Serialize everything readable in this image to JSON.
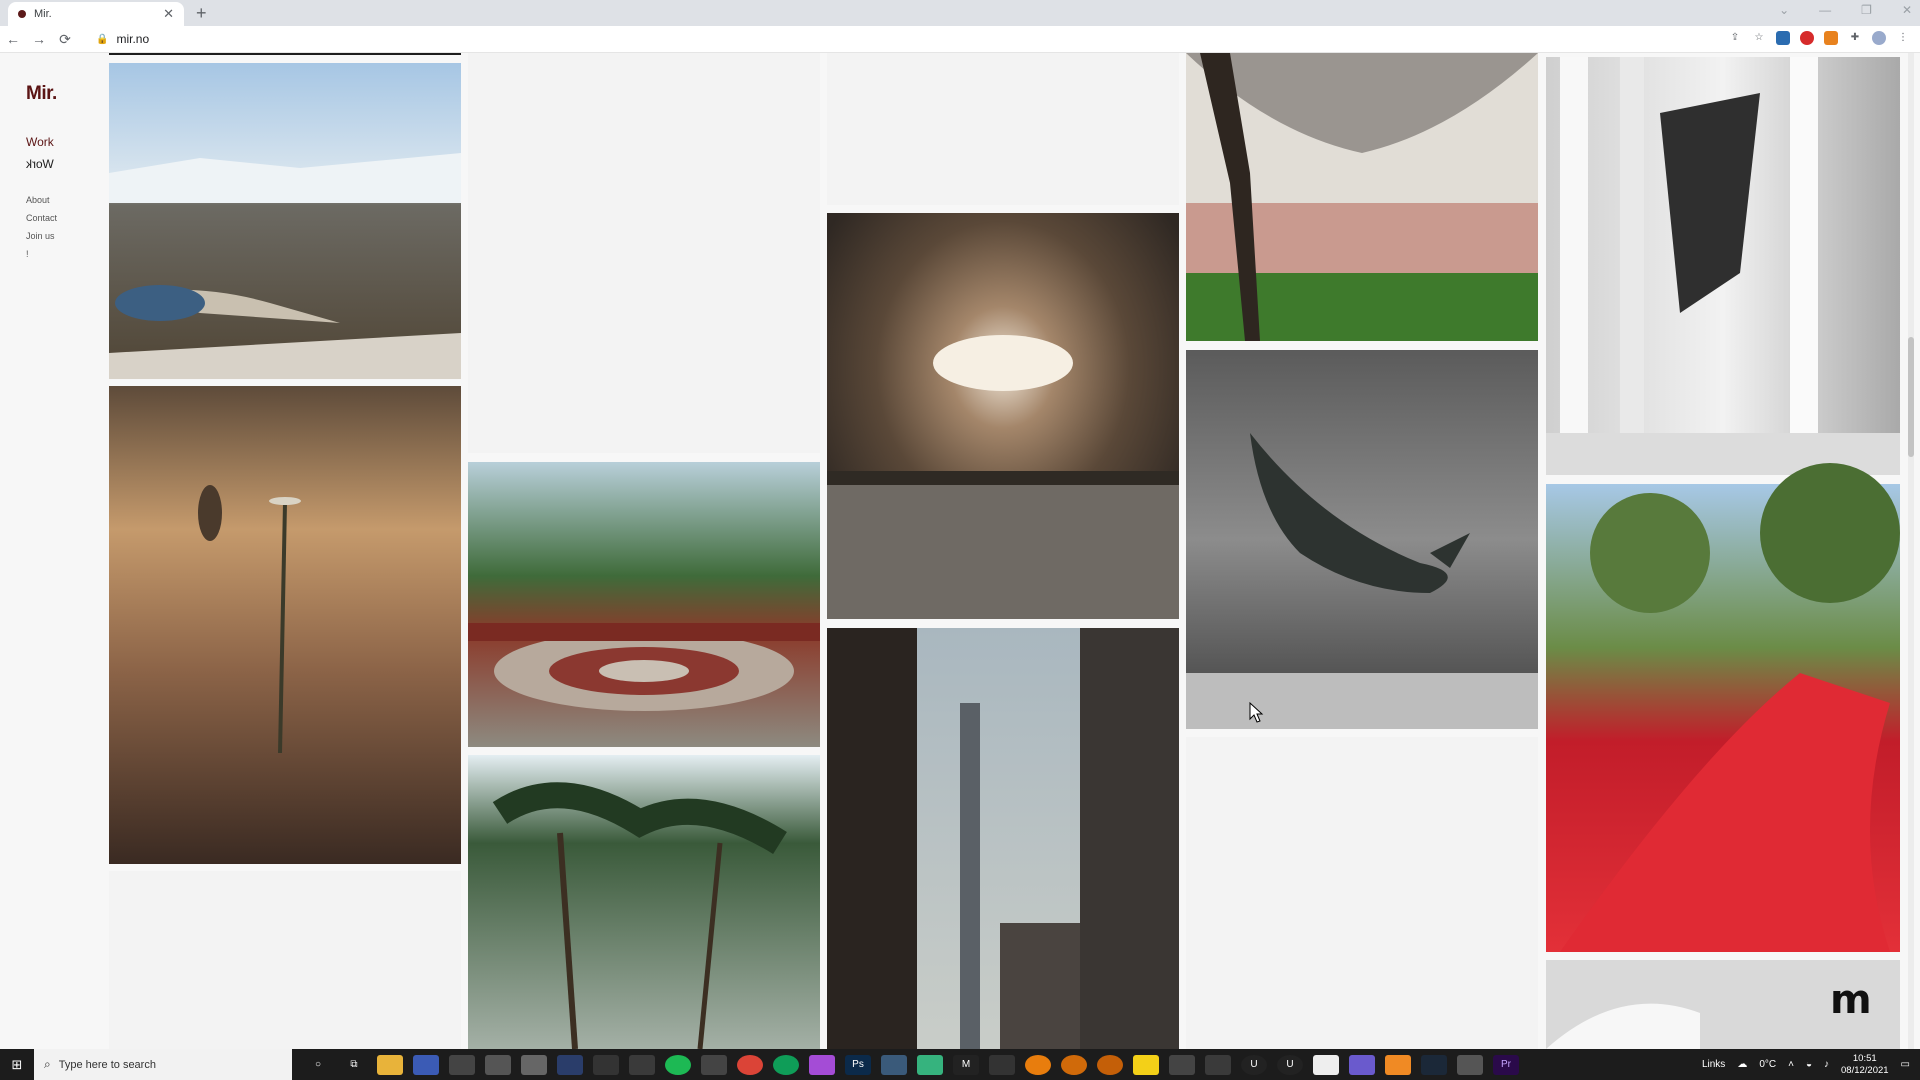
{
  "browser": {
    "tab_title": "Mir.",
    "tab_close": "✕",
    "new_tab": "+",
    "url": "mir.no",
    "back": "←",
    "forward": "→",
    "reload": "⟳",
    "window_controls": [
      "⌄",
      "—",
      "❐",
      "✕"
    ]
  },
  "site": {
    "logo": "Mir.",
    "nav": {
      "work": "Work",
      "work_mirrored": "Work"
    },
    "links": [
      "About",
      "Contact",
      "Join us",
      "!"
    ]
  },
  "taskbar": {
    "search_placeholder": "Type here to search",
    "tray_label": "Links",
    "temperature": "0°C",
    "time": "10:51",
    "date": "08/12/2021"
  },
  "colors": {
    "brand": "#5b1414",
    "page_bg": "#f7f7f7",
    "taskbar_bg": "#1c1c1c"
  }
}
